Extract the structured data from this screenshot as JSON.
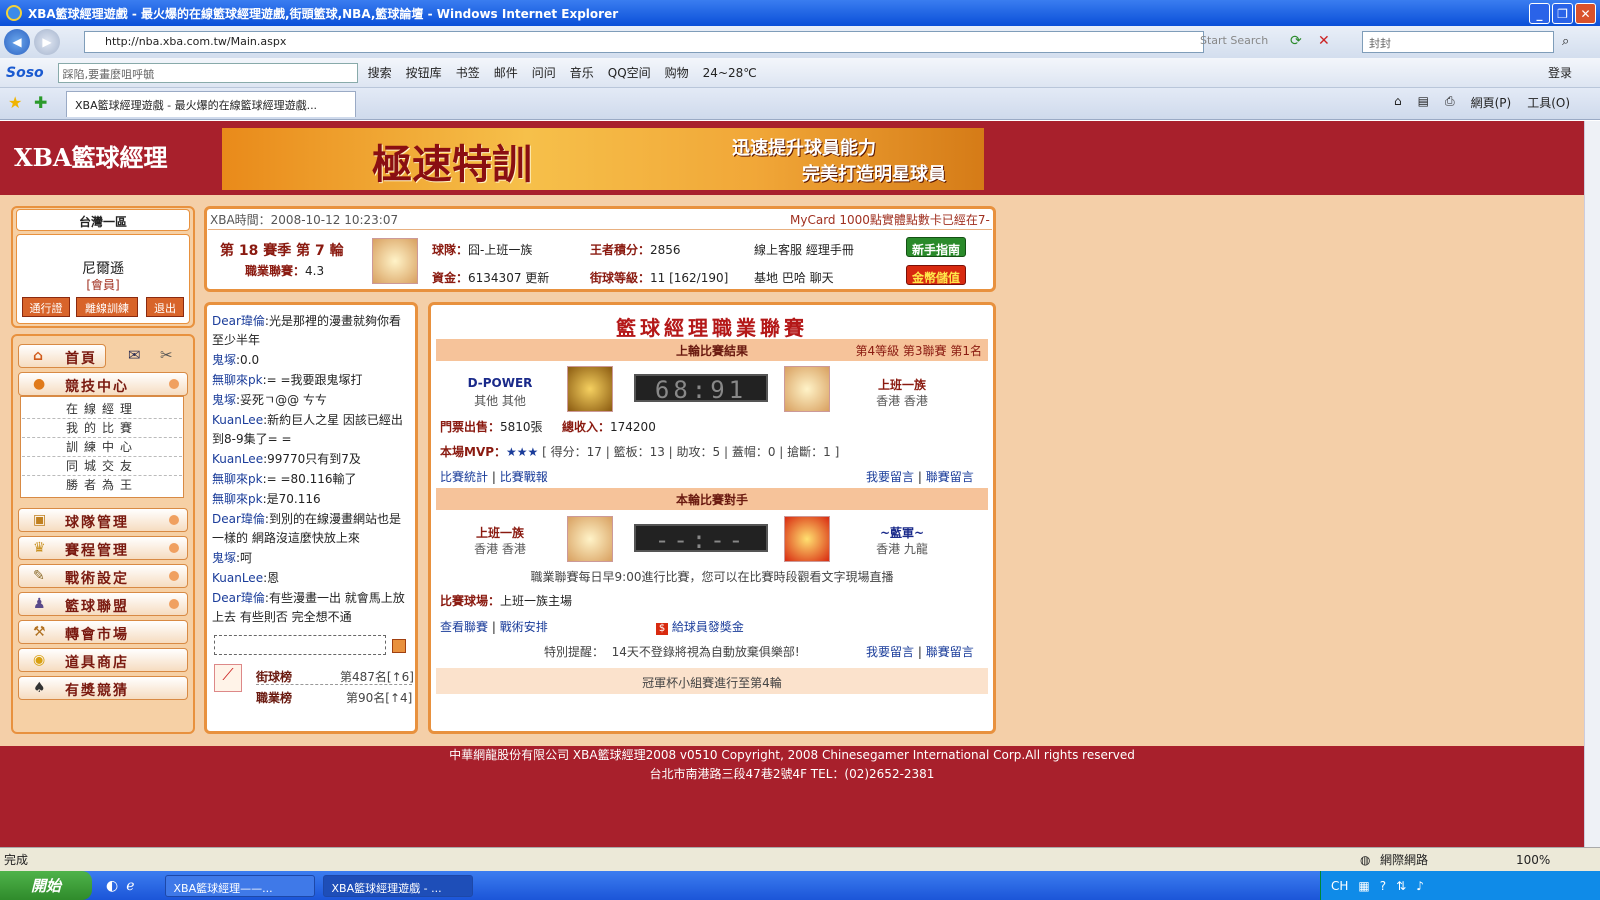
{
  "window": {
    "title": "XBA籃球經理遊戲 - 最火爆的在線籃球經理遊戲,街頭籃球,NBA,籃球論壇 - Windows Internet Explorer"
  },
  "address": {
    "url": "http://nba.xba.com.tw/Main.aspx",
    "start_search": "Start Search",
    "search_value": "封封"
  },
  "toolbar": {
    "brand": "Soso",
    "input_value": "踩陷,要畫麼咀呼毓",
    "search": "搜索",
    "items": [
      "按钮库",
      "书签",
      "邮件",
      "问问",
      "音乐",
      "QQ空间",
      "购物",
      "24~28℃"
    ],
    "login": "登录"
  },
  "tab": {
    "label": "XBA籃球經理遊戲 - 最火爆的在線籃球經理遊戲...",
    "page": "網頁(P)",
    "tools": "工具(O)"
  },
  "header": {
    "logo": "XBA籃球經理",
    "banner_main": "極速特訓",
    "banner_line1": "迅速提升球員能力",
    "banner_line2": "完美打造明星球員"
  },
  "user": {
    "region": "台灣一區",
    "name": "尼爾遜",
    "role": "[會員]",
    "buttons": [
      "通行證",
      "離線訓練",
      "退出"
    ]
  },
  "nav": {
    "home": "首頁",
    "items": [
      "競技中心",
      "球隊管理",
      "賽程管理",
      "戰術設定",
      "籃球聯盟",
      "轉會市場",
      "道具商店",
      "有獎競猜"
    ],
    "sub": [
      "在線經理",
      "我的比賽",
      "訓練中心",
      "同城交友",
      "勝者為王"
    ]
  },
  "info": {
    "time": "XBA時間：2008-10-12 10:23:07",
    "notice": "MyCard 1000點實體點數卡已經在7-",
    "season": "第 18 賽季  第 7 輪",
    "league_label": "職業聯賽：",
    "league_value": "4.3",
    "team_label": "球隊：",
    "team_value": "囧-上班一族",
    "king_label": "王者積分：",
    "king_value": "2856",
    "service": "線上客服  經理手冊",
    "guide_btn": "新手指南",
    "fund_label": "資金：",
    "fund_value": "6134307 更新",
    "level_label": "街球等級：",
    "level_value": "11 [162/190]",
    "base": "基地  巴哈  聊天",
    "deposit_btn": "金幣儲值"
  },
  "chat": {
    "lines": [
      {
        "who": "Dear瑋倫",
        "msg": ":光是那裡的漫畫就夠你看至少半年"
      },
      {
        "who": "鬼塚",
        "msg": ":0.0"
      },
      {
        "who": "無聊來pk",
        "msg": ":= =我要跟鬼塚打"
      },
      {
        "who": "鬼塚",
        "msg": ":妥死ㄱ@@ ㄘㄘ"
      },
      {
        "who": "KuanLee",
        "msg": ":新約巨人之星 因該已經出到8-9集了= ="
      },
      {
        "who": "KuanLee",
        "msg": ":99770只有到7及"
      },
      {
        "who": "無聊來pk",
        "msg": ":= =80.116輸了"
      },
      {
        "who": "無聊來pk",
        "msg": ":是70.116"
      },
      {
        "who": "Dear瑋倫",
        "msg": ":到別的在線漫畫網站也是一樣的 網路沒這麼快放上來"
      },
      {
        "who": "鬼塚",
        "msg": ":呵"
      },
      {
        "who": "KuanLee",
        "msg": ":恩"
      },
      {
        "who": "Dear瑋倫",
        "msg": ":有些漫畫一出 就會馬上放上去 有些則否 完全想不通"
      }
    ],
    "rank1_label": "街球榜",
    "rank1_value": "第487名[↑6]",
    "rank2_label": "職業榜",
    "rank2_value": "第90名[↑4]"
  },
  "league": {
    "title": "籃球經理職業聯賽",
    "last_title": "上輪比賽結果",
    "last_meta": "第4等級  第3聯賽  第1名",
    "home_team": "D-POWER",
    "home_loc": "其他 其他",
    "score": "68:91",
    "away_team": "上班一族",
    "away_loc": "香港 香港",
    "ticket_label": "門票出售：",
    "ticket_value": "5810張",
    "income_label": "總收入：",
    "income_value": "174200",
    "mvp_label": "本場MVP：",
    "mvp_stars": "★★★",
    "mvp_stats": "[ 得分：17 | 籃板：13 | 助攻：5 | 蓋帽：0 | 搶斷：1 ]",
    "stats_link": "比賽統計",
    "report_link": "比賽戰報",
    "msg_link": "我要留言",
    "league_msg_link": "聯賽留言",
    "next_title": "本輪比賽對手",
    "next_home": "上班一族",
    "next_home_loc": "香港 香港",
    "next_score": "--:--",
    "next_away": "~藍軍~",
    "next_away_loc": "香港 九龍",
    "schedule_note": "職業聯賽每日早9:00進行比賽，您可以在比賽時段觀看文字現場直播",
    "venue_label": "比賽球場：",
    "venue_value": "上班一族主場",
    "view_league": "查看聯賽",
    "tactic": "戰術安排",
    "bonus": "給球員發獎金",
    "reminder_label": "特別提醒：",
    "reminder": "14天不登錄將視為自動放棄俱樂部!",
    "cup": "冠軍杯小組賽進行至第4輪"
  },
  "footer": {
    "line1": "中華網龍股份有限公司  XBA籃球經理2008 v0510    Copyright‚ 2008 Chinesegamer International Corp.All rights reserved",
    "line2": "台北市南港路三段47巷2號4F TEL：(02)2652-2381"
  },
  "status": {
    "left": "完成",
    "zone": "網際網路",
    "zoom": "100%"
  },
  "taskbar": {
    "start": "開始",
    "task1": "XBA籃球經理——...",
    "task2": "XBA籃球經理遊戲 - ...",
    "lang": "CH"
  },
  "colors": {
    "header": "#a8202c",
    "page_bg": "#f4cfa8",
    "accent": "#e8913e"
  }
}
